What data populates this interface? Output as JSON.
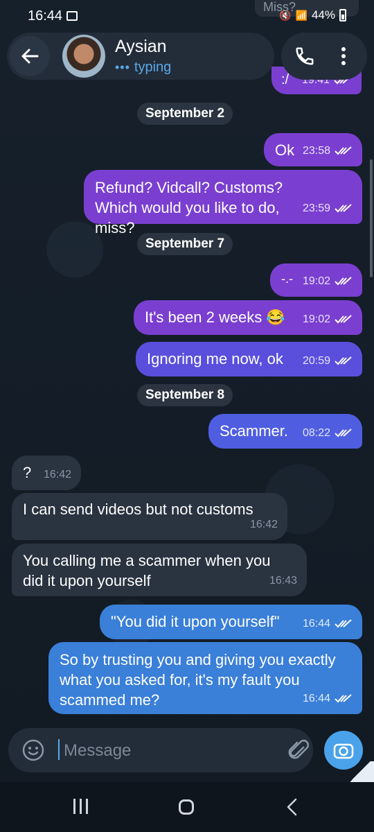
{
  "status_bar": {
    "time": "16:44",
    "battery": "44%"
  },
  "partial_top_bubble": "Miss?",
  "header": {
    "contact_name": "Aysian",
    "status": "typing",
    "typing_dots": "•••"
  },
  "messages": [
    {
      "kind": "out",
      "text": ":/",
      "time": "19:41"
    },
    {
      "kind": "date",
      "text": "September 2"
    },
    {
      "kind": "out",
      "text": "Ok",
      "time": "23:58"
    },
    {
      "kind": "out",
      "text": "Refund? Vidcall? Customs? Which would you like to do, miss?",
      "time": "23:59"
    },
    {
      "kind": "date",
      "text": "September 7"
    },
    {
      "kind": "out",
      "text": "-.-",
      "time": "19:02"
    },
    {
      "kind": "out",
      "text": "It's been 2 weeks 😂",
      "time": "19:02"
    },
    {
      "kind": "out",
      "text": "Ignoring me now, ok",
      "time": "20:59"
    },
    {
      "kind": "date",
      "text": "September 8"
    },
    {
      "kind": "out",
      "text": "Scammer.",
      "time": "08:22"
    },
    {
      "kind": "in",
      "text": "?",
      "time": "16:42"
    },
    {
      "kind": "in",
      "text": "I can send videos but not customs",
      "time": "16:42"
    },
    {
      "kind": "in",
      "text": "You calling me a scammer when you did it upon yourself",
      "time": "16:43"
    },
    {
      "kind": "out",
      "text": "\"You did it upon yourself\"",
      "time": "16:44"
    },
    {
      "kind": "out",
      "text": "So by trusting you and giving you exactly what you asked for, it's my fault you scammed me?",
      "time": "16:44"
    }
  ],
  "composer": {
    "placeholder": "Message"
  },
  "colors": {
    "accent": "#4aa3ea",
    "bubble_purple": "#7a3fd0",
    "bubble_violet": "#5a4fdc",
    "bubble_blue": "#3a7fd8",
    "bubble_incoming": "#2a3340",
    "background": "#141c24"
  }
}
